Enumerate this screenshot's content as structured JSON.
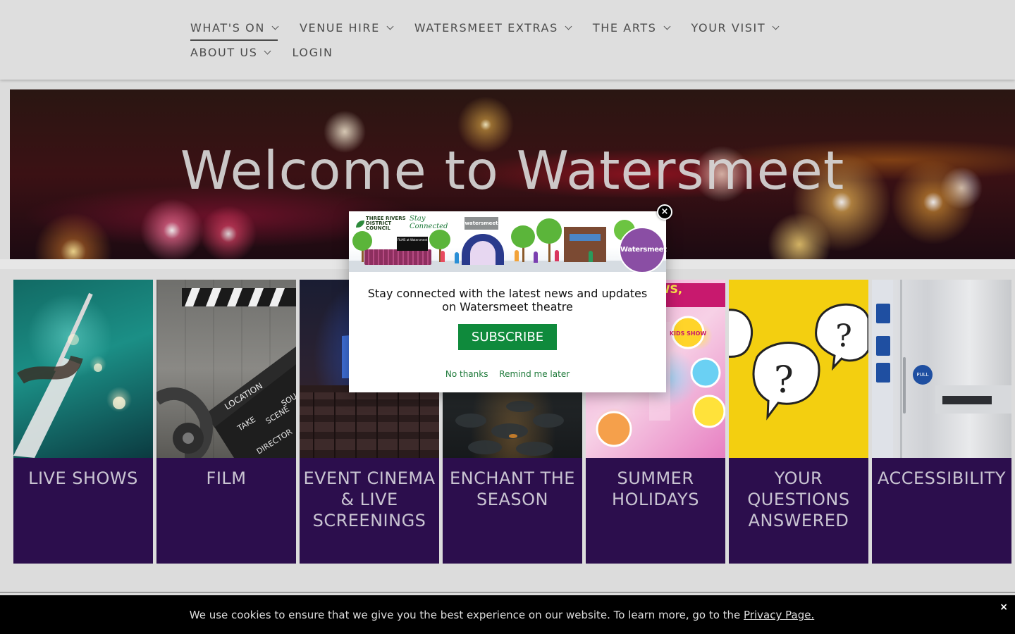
{
  "nav": {
    "row1": [
      {
        "label": "WHAT'S ON",
        "active": true
      },
      {
        "label": "VENUE HIRE"
      },
      {
        "label": "WATERSMEET EXTRAS"
      },
      {
        "label": "THE ARTS"
      },
      {
        "label": "YOUR VISIT"
      }
    ],
    "row2": [
      {
        "label": "ABOUT US"
      },
      {
        "label": "LOGIN"
      }
    ]
  },
  "hero": {
    "title": "Welcome to Watersmeet"
  },
  "tiles": [
    {
      "label": "LIVE SHOWS"
    },
    {
      "label": "FILM"
    },
    {
      "label": "EVENT CINEMA & LIVE SCREENINGS"
    },
    {
      "label": "ENCHANT THE SEASON"
    },
    {
      "label": "SUMMER HOLIDAYS"
    },
    {
      "label": "YOUR QUESTIONS ANSWERED"
    },
    {
      "label": "ACCESSIBILITY"
    }
  ],
  "tile_images": {
    "film": {
      "clapper_lines": [
        "LOCATION",
        "TAKE",
        "SCENE",
        "DIRECTOR",
        "SOU"
      ]
    },
    "summer": {
      "banner": "S, SHOWS, EVENTS",
      "badge": "KIDS SHOW"
    },
    "accessibility": {
      "pull_label": "PULL"
    }
  },
  "modal": {
    "banner": {
      "council": "THREE RIVERS DISTRICT COUNCIL",
      "stay_connected": "Stay Connected",
      "venue_logo": "watersmeet",
      "screen_text": "FILMS at Watersmeet",
      "badge": "Watersmeet"
    },
    "message": "Stay connected with the latest news and updates on Watersmeet theatre",
    "subscribe_label": "SUBSCRIBE",
    "no_thanks_label": "No thanks",
    "remind_label": "Remind me later",
    "close_glyph": "×"
  },
  "cookie": {
    "text": "We use cookies to ensure that we give you the best experience on our website. To learn more, go to the ",
    "link_label": "Privacy Page.",
    "close_glyph": "×"
  },
  "colors": {
    "tile_label_bg": "#2c0e4d",
    "subscribe_green": "#0f8a3c",
    "badge_purple": "#8a4ea4",
    "header_bg": "#dedede"
  }
}
